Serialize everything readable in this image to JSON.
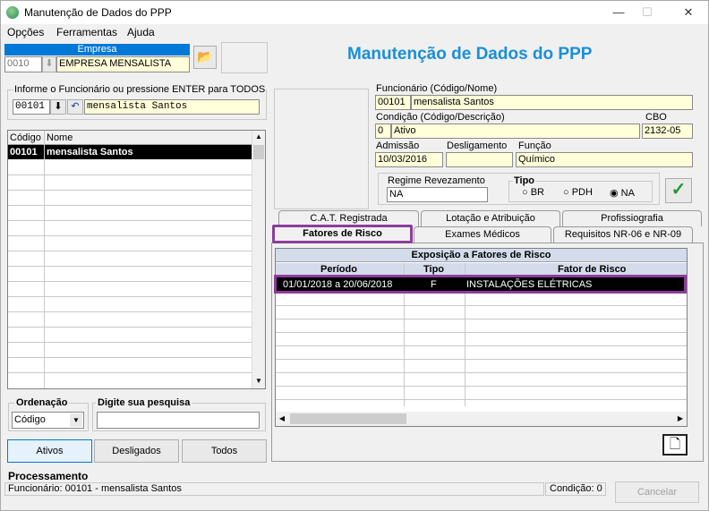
{
  "window": {
    "title": "Manutenção de Dados do PPP",
    "min": "—",
    "max": "☐",
    "close": "✕"
  },
  "menu": [
    {
      "label": "Opções"
    },
    {
      "label": "Ferramentas"
    },
    {
      "label": "Ajuda"
    }
  ],
  "empresa": {
    "header": "Empresa",
    "code": "0010",
    "name": "EMPRESA MENSALISTA"
  },
  "page_title": "Manutenção de Dados do PPP",
  "funcionario_search": {
    "label": "Informe o Funcionário ou pressione ENTER para TODOS",
    "code": "00101",
    "name": "mensalista Santos"
  },
  "employee_list": {
    "headers": [
      "Código",
      "Nome"
    ],
    "rows": [
      {
        "code": "00101",
        "name": "mensalista Santos"
      }
    ]
  },
  "ordenacao": {
    "label": "Ordenação",
    "value": "Código"
  },
  "pesquisa": {
    "label": "Digite sua pesquisa",
    "value": ""
  },
  "filters": {
    "ativos": "Ativos",
    "desligados": "Desligados",
    "todos": "Todos"
  },
  "details": {
    "funcionario_label": "Funcionário (Código/Nome)",
    "func_code": "00101",
    "func_name": "mensalista Santos",
    "condicao_label": "Condição (Código/Descrição)",
    "cond_code": "0",
    "cond_desc": "Ativo",
    "cbo_label": "CBO",
    "cbo": "2132-05",
    "admissao_label": "Admissão",
    "admissao": "10/03/2016",
    "desligamento_label": "Desligamento",
    "desligamento": "",
    "funcao_label": "Função",
    "funcao": "Químico",
    "regime_label": "Regime Revezamento",
    "regime": "NA",
    "tipo_label": "Tipo",
    "tipo_options": [
      "BR",
      "PDH",
      "NA"
    ],
    "tipo_selected": "NA"
  },
  "tabs": {
    "row1": [
      "C.A.T. Registrada",
      "Lotação e Atribuição",
      "Profissiografia"
    ],
    "row2": [
      "Fatores de Risco",
      "Exames Médicos",
      "Requisitos NR-06 e NR-09"
    ],
    "active": "Fatores de Risco"
  },
  "risk_table": {
    "title": "Exposição a Fatores de Risco",
    "headers": [
      "Período",
      "Tipo",
      "Fator de Risco"
    ],
    "rows": [
      {
        "periodo": "01/01/2018 a 20/06/2018",
        "tipo": "F",
        "fator": "INSTALAÇÕES ELÉTRICAS"
      }
    ]
  },
  "status": {
    "section": "Processamento",
    "text": "Funcionário: 00101 - mensalista Santos",
    "condicao": "Condição: 0",
    "cancel": "Cancelar"
  },
  "highlight_color": "#8e3c9c"
}
